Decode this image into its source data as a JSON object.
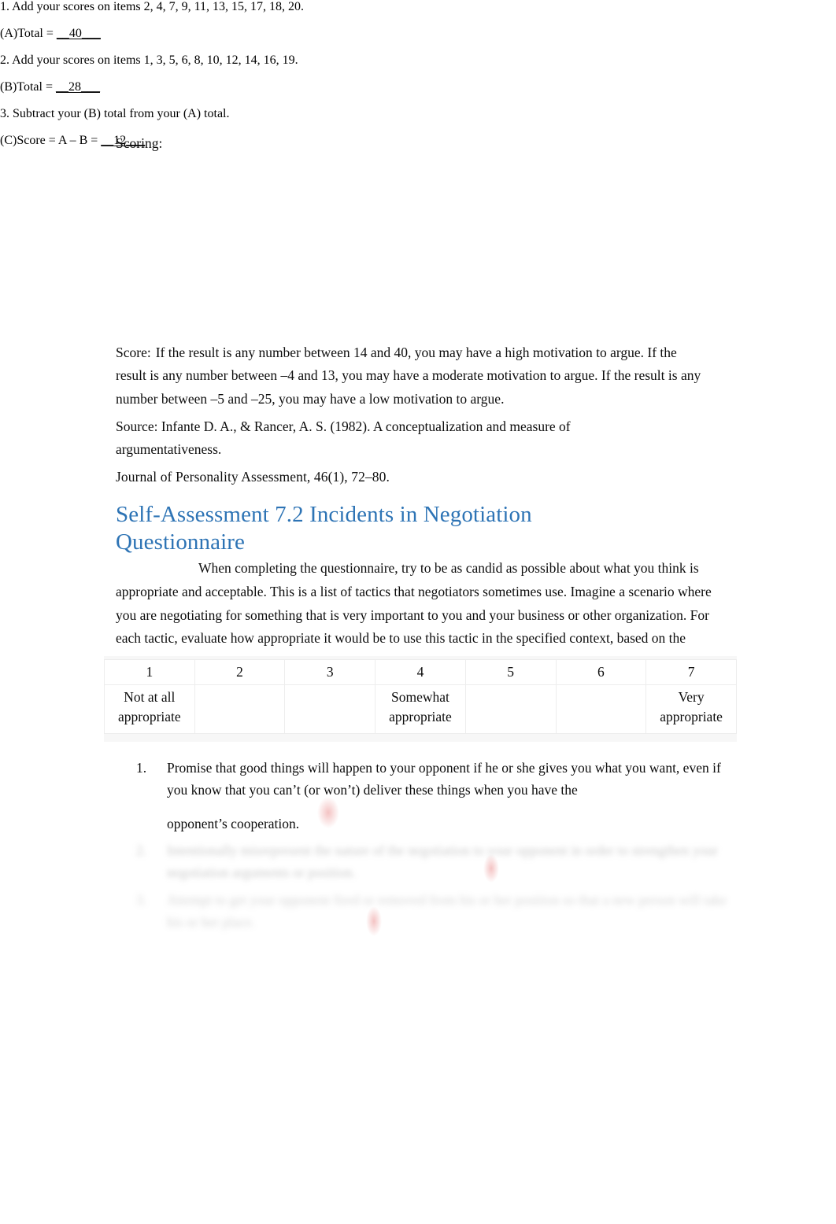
{
  "document": {
    "scoring_label": "Scoring:",
    "scoring_steps": [
      {
        "id": "step-1",
        "text": "1. Add your scores on items 2, 4, 7, 9, 11, 13, 15, 17, 18, 20."
      },
      {
        "id": "total-a",
        "prefix": "(A)Total = ",
        "blank_before": "__",
        "value": "40",
        "blank_after": "___"
      },
      {
        "id": "step-2",
        "text": "2. Add your scores on items 1, 3, 5, 6, 8, 10, 12, 14, 16, 19."
      },
      {
        "id": "total-b",
        "prefix": "(B)Total = ",
        "blank_before": "__",
        "value": "28",
        "blank_after": "___"
      },
      {
        "id": "step-3",
        "text": "3. Subtract your (B) total from your (A) total."
      },
      {
        "id": "score-c",
        "prefix": "(C)Score = A – B = ",
        "blank_before": "__",
        "value": "12",
        "blank_after": "___"
      }
    ],
    "score_interpretation": {
      "lead": "Score:",
      "text": "If the result is any number between 14 and 40, you may have a high motivation to argue. If the result is any number between –4 and 13, you may have a moderate motivation to argue. If the result is any number between –5 and –25, you may have a low motivation to argue."
    },
    "source_note": "Source: Infante D. A., & Rancer, A. S. (1982). A conceptualization and measure of argumentativeness.",
    "journal_note": "Journal of Personality Assessment, 46(1), 72–80.",
    "heading": {
      "text": "Self-Assessment 7.2 Incidents in Negotiation Questionnaire",
      "color": "#2E74B5"
    },
    "instructions": "When completing the questionnaire, try to be as candid as possible about what you think is appropriate and acceptable. This is a list of tactics that negotiators sometimes use. Imagine a scenario where you are negotiating for something that is very important to you and your business or other organization. For each tactic, evaluate how appropriate it would be to use this tactic in the specified context, based on the scale provided.",
    "scale_table": {
      "numbers": [
        "1",
        "2",
        "3",
        "4",
        "5",
        "6",
        "7"
      ],
      "labels": [
        "Not at all appropriate",
        "",
        "",
        "Somewhat appropriate",
        "",
        "",
        "Very appropriate"
      ]
    },
    "tactics": [
      {
        "number": "1.",
        "text": "Promise that good things will happen to your opponent if he or she gives you what you want, even if you know that you can’t (or won’t) deliver these things when you have the",
        "tail": "opponent’s cooperation.",
        "obscured": false
      },
      {
        "number": "2.",
        "text": "Intentionally misrepresent the nature of the negotiation to your opponent in order to strengthen your negotiation arguments or position.",
        "tail": "",
        "obscured": true
      },
      {
        "number": "3.",
        "text": "Attempt to get your opponent fired or removed from his or her position so that a new person will take his or her place.",
        "tail": "",
        "obscured": true
      }
    ]
  }
}
